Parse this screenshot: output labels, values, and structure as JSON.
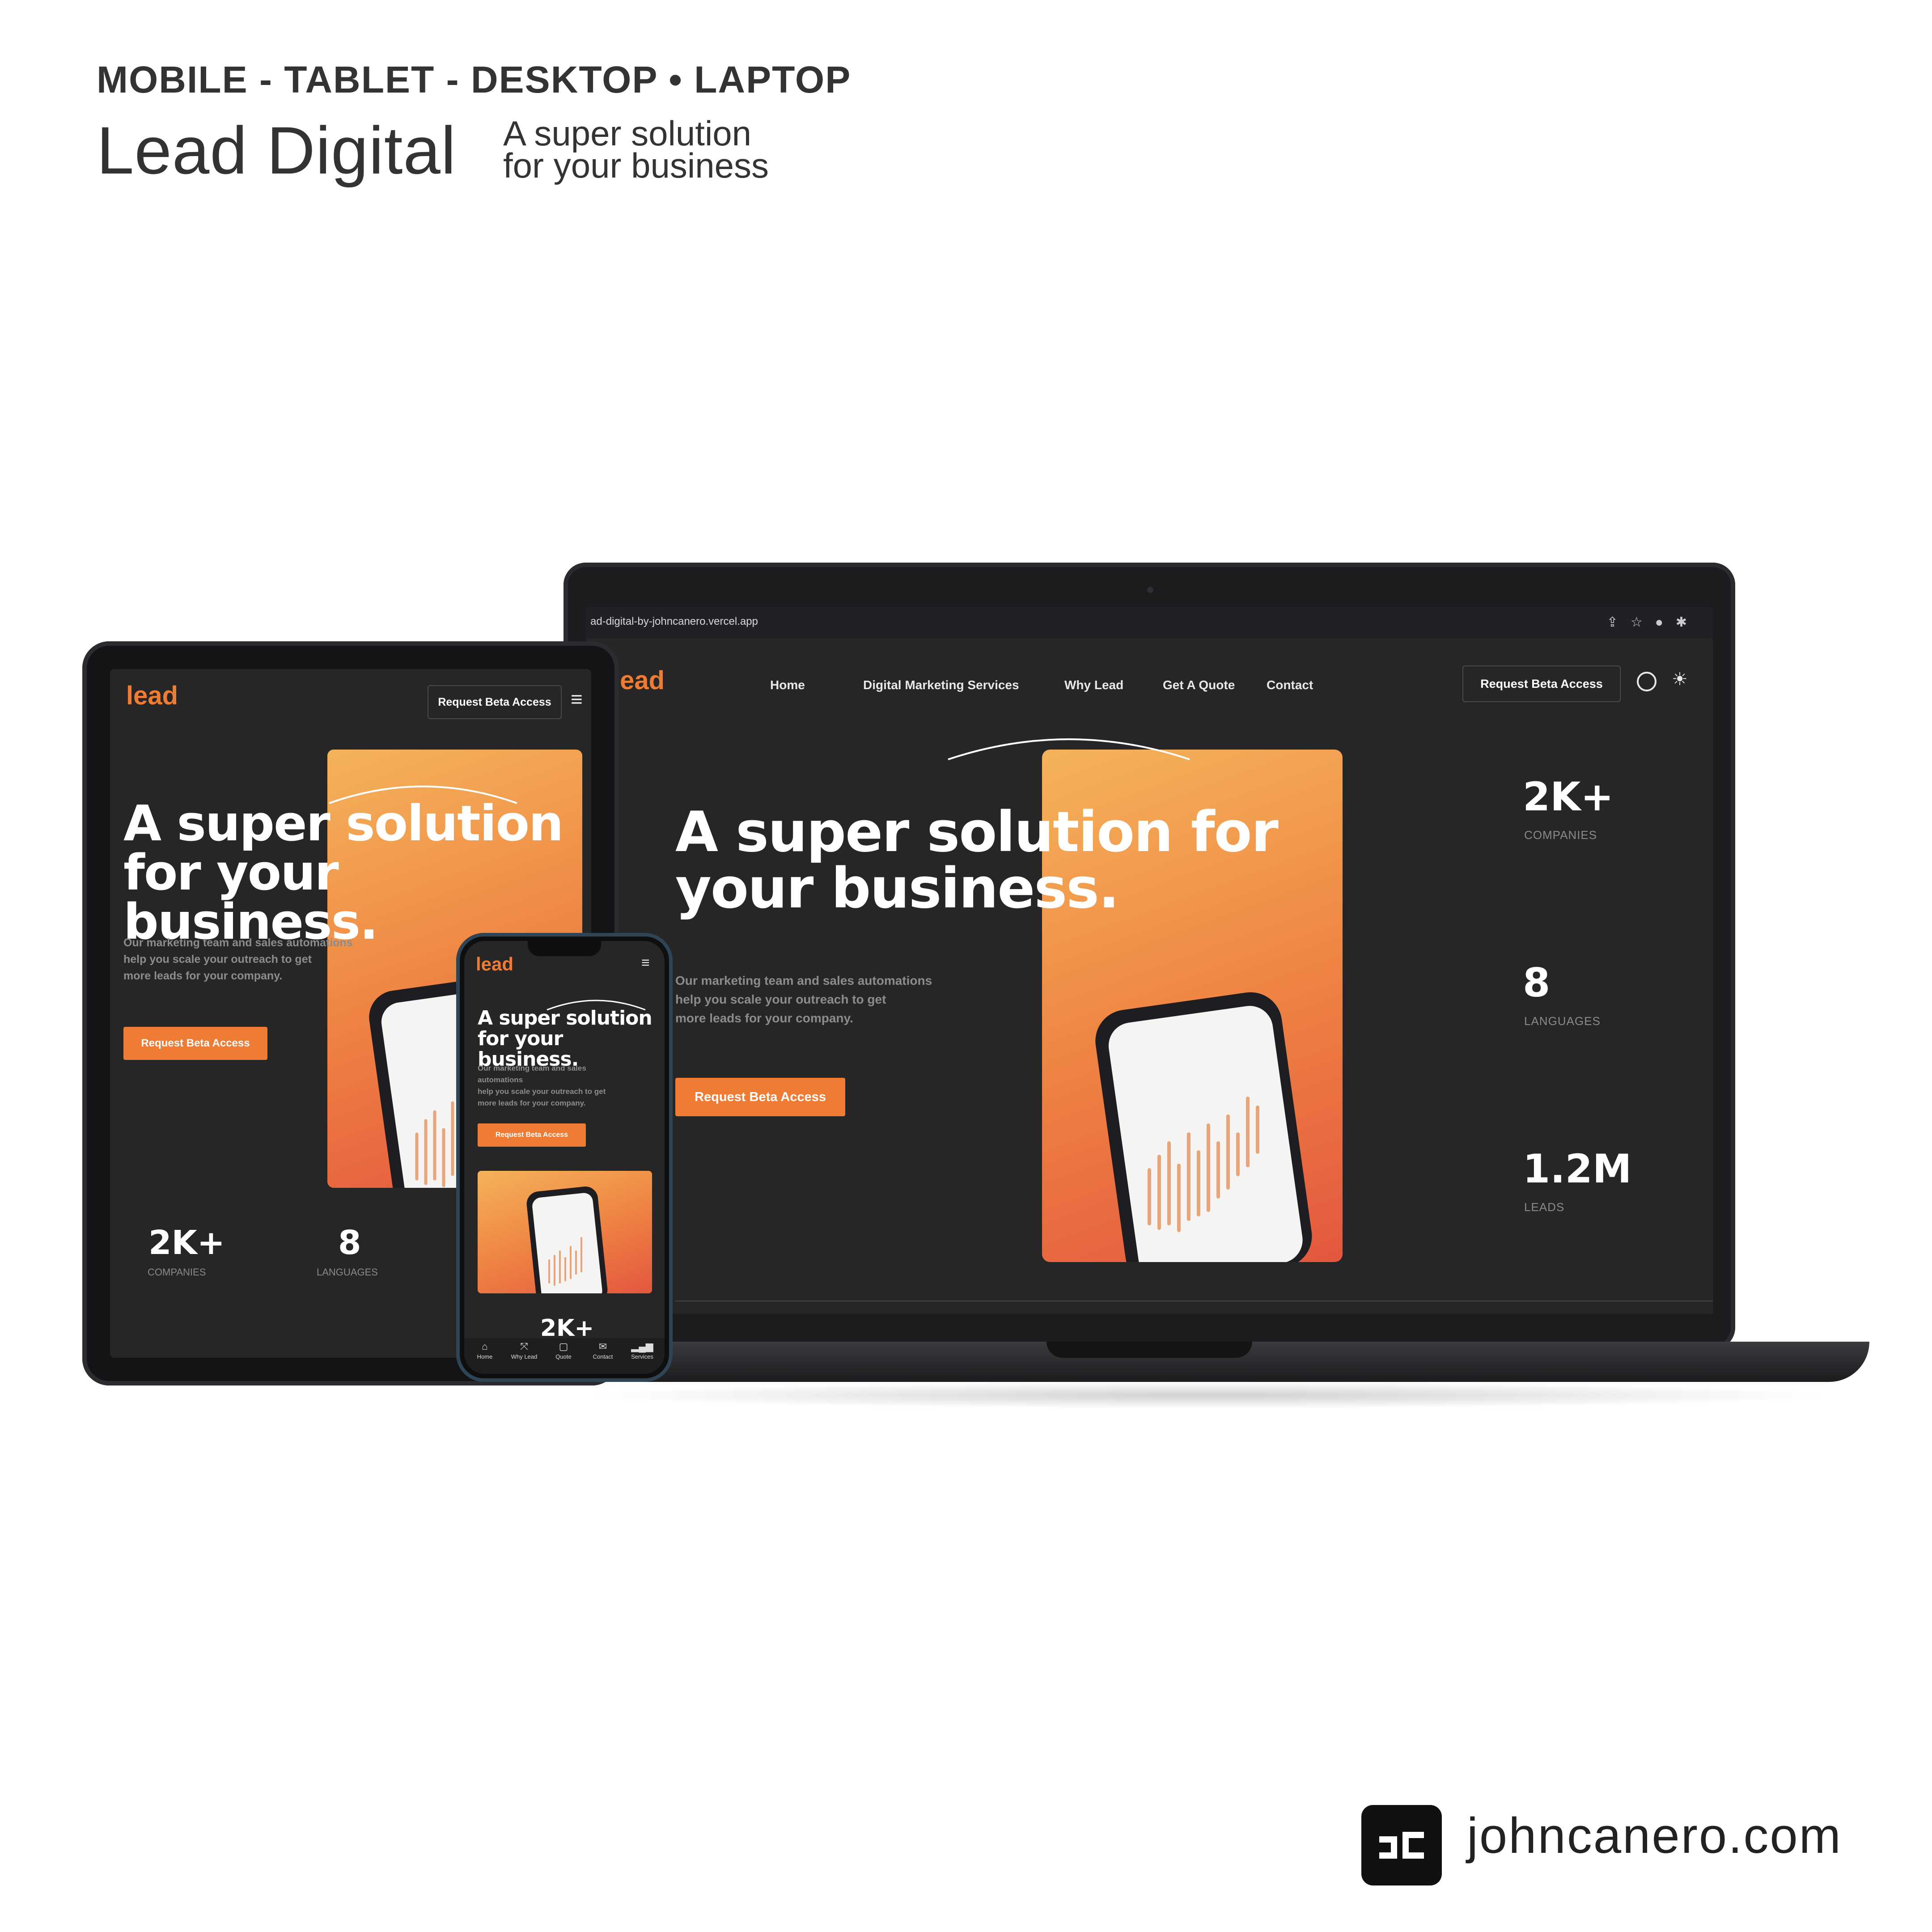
{
  "header": {
    "devices": "MOBILE - TABLET - DESKTOP • LAPTOP",
    "title": "Lead Digital",
    "tagline_line1": "A super solution",
    "tagline_line2": "for your business"
  },
  "browser": {
    "url": "ad-digital-by-johncanero.vercel.app"
  },
  "site": {
    "logo": "lead",
    "nav": [
      "Home",
      "Digital Marketing Services",
      "Why Lead",
      "Get A Quote",
      "Contact"
    ],
    "cta_outline": "Request Beta Access",
    "headline_line1": "A super solution for",
    "headline_line2": "your business.",
    "subtext_lines": [
      "Our marketing team and sales automations",
      "help you scale your outreach to get",
      "more leads for your company."
    ],
    "primary_cta": "Request Beta Access",
    "stats": [
      {
        "value": "2K+",
        "label": "COMPANIES"
      },
      {
        "value": "8",
        "label": "LANGUAGES"
      },
      {
        "value": "1.2M",
        "label": "LEADS"
      }
    ],
    "accent": "#ef7c34",
    "bg": "#262626"
  },
  "tablet": {
    "headline_line1": "A super solution",
    "headline_line2": "for your business.",
    "subtext_lines": [
      "Our marketing team and sales automations",
      "help you scale your outreach to get",
      "more leads for your company."
    ]
  },
  "mobile": {
    "headline_line1": "A super solution",
    "headline_line2": "for your business.",
    "subtext_lines": [
      "Our marketing team and sales",
      "automations",
      "help you scale your outreach to get",
      "more leads for your company."
    ],
    "stat": "2K+",
    "tabs": [
      {
        "label": "Home",
        "icon": "home-icon"
      },
      {
        "label": "Why Lead",
        "icon": "expand-icon"
      },
      {
        "label": "Quote",
        "icon": "chat-icon"
      },
      {
        "label": "Contact",
        "icon": "mail-icon"
      },
      {
        "label": "Services",
        "icon": "signal-icon"
      }
    ]
  },
  "footer": {
    "website": "johncanero.com"
  }
}
